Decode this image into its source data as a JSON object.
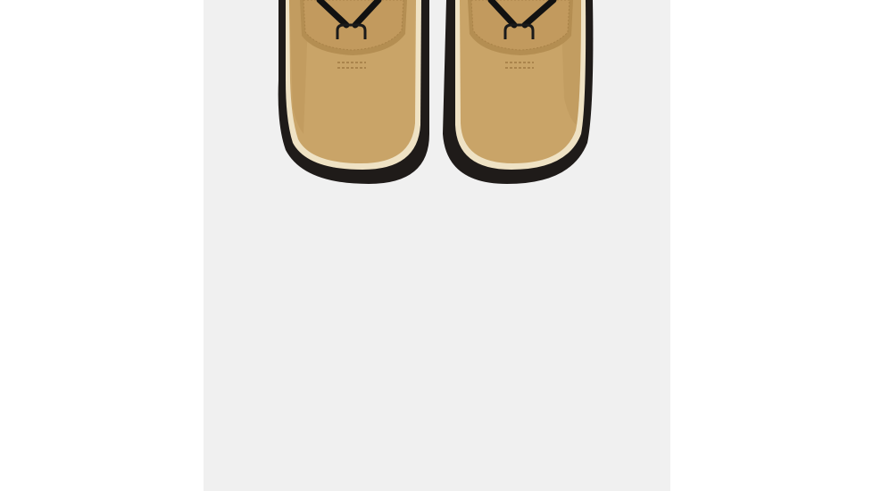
{
  "image": {
    "subject": "boots-top-view",
    "colors": {
      "page_background": "#ffffff",
      "panel_background": "#f0f0f0",
      "suede": "#c9a468",
      "suede_shadow": "#b48e52",
      "midsole_trim": "#efe2c4",
      "rubber_sole": "#1f1b19",
      "lace": "#111111"
    }
  }
}
